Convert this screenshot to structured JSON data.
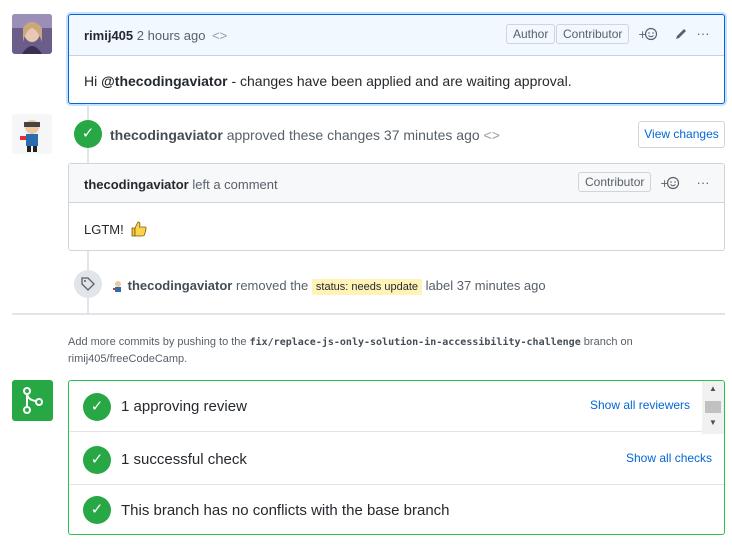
{
  "comment1": {
    "author": "rimij405",
    "time": "2 hours ago",
    "badges": [
      "Author",
      "Contributor"
    ],
    "body_prefix": "Hi ",
    "mention": "@thecodingaviator",
    "body_suffix": " - changes have been applied and are waiting approval."
  },
  "approval": {
    "author": "thecodingaviator",
    "text": "approved these changes 37 minutes ago",
    "button": "View changes"
  },
  "comment2": {
    "author": "thecodingaviator",
    "action": "left a comment",
    "badge": "Contributor",
    "body": "LGTM!"
  },
  "label_event": {
    "author": "thecodingaviator",
    "removed": "removed the",
    "label": "status: needs update",
    "suffix": "label 37 minutes ago"
  },
  "info": {
    "prefix": "Add more commits by pushing to the",
    "branch": "fix/replace-js-only-solution-in-accessibility-challenge",
    "middle": "branch on",
    "repo": "rimij405/freeCodeCamp."
  },
  "merge": {
    "rows": [
      {
        "title": "1 approving review",
        "link": "Show all reviewers"
      },
      {
        "title": "1 successful check",
        "link": "Show all checks"
      },
      {
        "title": "This branch has no conflicts with the base branch",
        "link": ""
      }
    ]
  },
  "colors": {
    "green": "#28a745",
    "blue": "#0366d6",
    "label_bg": "#fff3b8"
  },
  "icons": [
    "check-icon",
    "code-icon",
    "smiley-icon",
    "pencil-icon",
    "kebab-icon",
    "tag-icon",
    "merge-icon",
    "thumbs-up-icon"
  ]
}
